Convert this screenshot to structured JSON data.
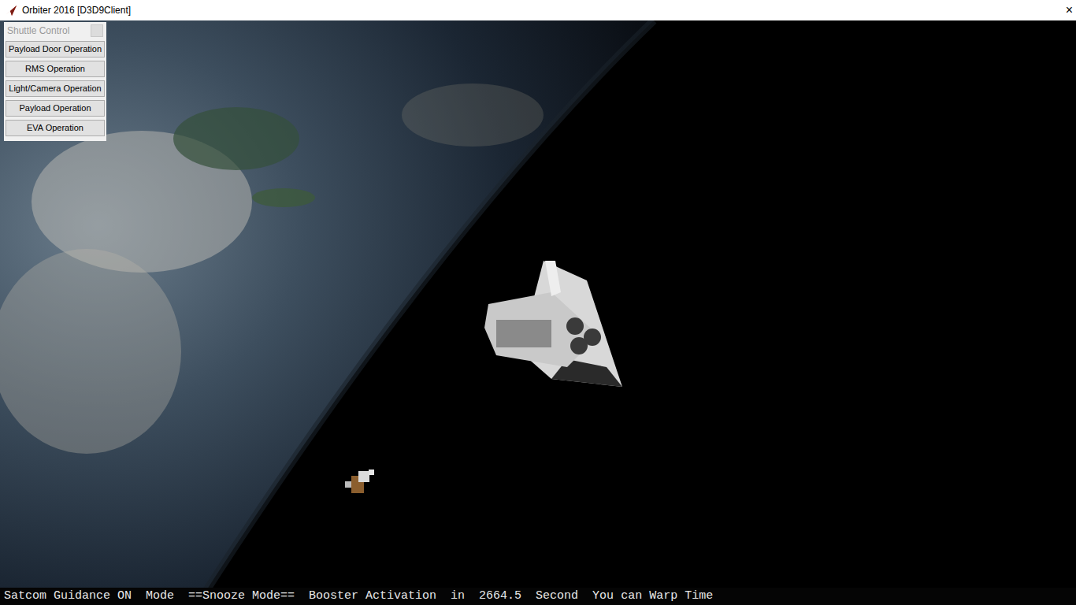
{
  "window": {
    "title": "Orbiter 2016 [D3D9Client]",
    "close": "×"
  },
  "shuttle_control": {
    "title": "Shuttle Control",
    "buttons": [
      "Payload Door Operation",
      "RMS Operation",
      "Light/Camera Operation",
      "Payload Operation",
      "EVA Operation"
    ]
  },
  "status_bar": {
    "text": "Satcom Guidance ON  Mode  ==Snooze Mode==  Booster Activation  in  2664.5  Second  You can Warp Time"
  }
}
